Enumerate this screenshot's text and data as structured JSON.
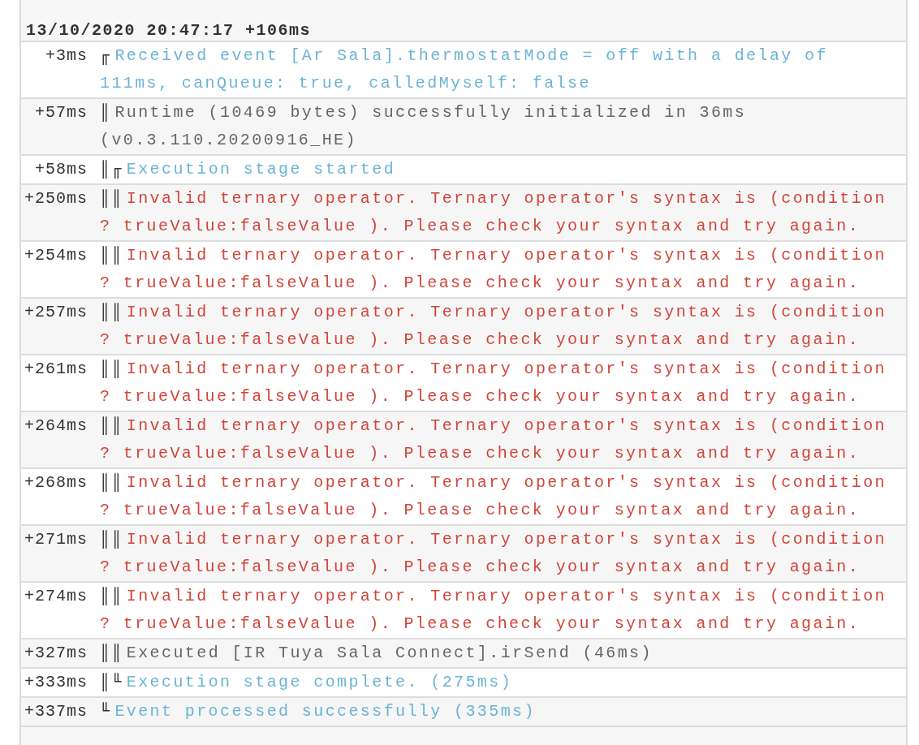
{
  "log": {
    "header": "13/10/2020 20:47:17 +106ms",
    "rows": [
      {
        "time": "+3ms",
        "prefix": "╓",
        "kind": "info",
        "message": "Received event [Ar Sala].thermostatMode = off with a delay of 111ms, canQueue: true, calledMyself: false"
      },
      {
        "time": "+57ms",
        "prefix": "║",
        "kind": "plain",
        "message": "Runtime (10469 bytes) successfully initialized in 36ms (v0.3.110.20200916_HE)"
      },
      {
        "time": "+58ms",
        "prefix": "║╓",
        "kind": "info",
        "message": "Execution stage started"
      },
      {
        "time": "+250ms",
        "prefix": "║║",
        "kind": "error",
        "message": "Invalid ternary operator. Ternary operator's syntax is (condition ? trueValue:falseValue ). Please check your syntax and try again."
      },
      {
        "time": "+254ms",
        "prefix": "║║",
        "kind": "error",
        "message": "Invalid ternary operator. Ternary operator's syntax is (condition ? trueValue:falseValue ). Please check your syntax and try again."
      },
      {
        "time": "+257ms",
        "prefix": "║║",
        "kind": "error",
        "message": "Invalid ternary operator. Ternary operator's syntax is (condition ? trueValue:falseValue ). Please check your syntax and try again."
      },
      {
        "time": "+261ms",
        "prefix": "║║",
        "kind": "error",
        "message": "Invalid ternary operator. Ternary operator's syntax is (condition ? trueValue:falseValue ). Please check your syntax and try again."
      },
      {
        "time": "+264ms",
        "prefix": "║║",
        "kind": "error",
        "message": "Invalid ternary operator. Ternary operator's syntax is (condition ? trueValue:falseValue ). Please check your syntax and try again."
      },
      {
        "time": "+268ms",
        "prefix": "║║",
        "kind": "error",
        "message": "Invalid ternary operator. Ternary operator's syntax is (condition ? trueValue:falseValue ). Please check your syntax and try again."
      },
      {
        "time": "+271ms",
        "prefix": "║║",
        "kind": "error",
        "message": "Invalid ternary operator. Ternary operator's syntax is (condition ? trueValue:falseValue ). Please check your syntax and try again."
      },
      {
        "time": "+274ms",
        "prefix": "║║",
        "kind": "error",
        "message": "Invalid ternary operator. Ternary operator's syntax is (condition ? trueValue:falseValue ). Please check your syntax and try again."
      },
      {
        "time": "+327ms",
        "prefix": "║║",
        "kind": "plain",
        "message": "Executed [IR Tuya Sala Connect].irSend (46ms)"
      },
      {
        "time": "+333ms",
        "prefix": "║╙",
        "kind": "info",
        "message": "Execution stage complete. (275ms)"
      },
      {
        "time": "+337ms",
        "prefix": "╙",
        "kind": "info",
        "message": "Event processed successfully (335ms)"
      }
    ]
  }
}
